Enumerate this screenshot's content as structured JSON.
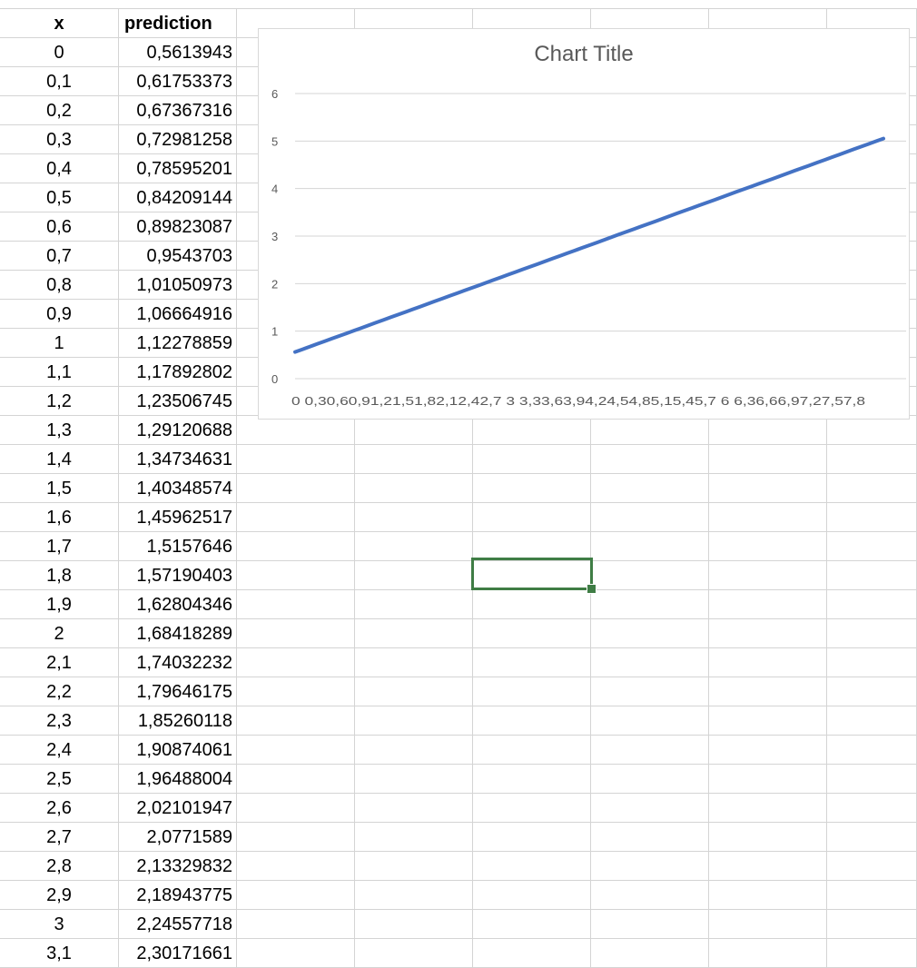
{
  "sheet": {
    "headers": {
      "x": "x",
      "prediction": "prediction"
    },
    "rows": [
      {
        "x": "0",
        "prediction": "0,5613943"
      },
      {
        "x": "0,1",
        "prediction": "0,61753373"
      },
      {
        "x": "0,2",
        "prediction": "0,67367316"
      },
      {
        "x": "0,3",
        "prediction": "0,72981258"
      },
      {
        "x": "0,4",
        "prediction": "0,78595201"
      },
      {
        "x": "0,5",
        "prediction": "0,84209144"
      },
      {
        "x": "0,6",
        "prediction": "0,89823087"
      },
      {
        "x": "0,7",
        "prediction": "0,9543703"
      },
      {
        "x": "0,8",
        "prediction": "1,01050973"
      },
      {
        "x": "0,9",
        "prediction": "1,06664916"
      },
      {
        "x": "1",
        "prediction": "1,12278859"
      },
      {
        "x": "1,1",
        "prediction": "1,17892802"
      },
      {
        "x": "1,2",
        "prediction": "1,23506745"
      },
      {
        "x": "1,3",
        "prediction": "1,29120688"
      },
      {
        "x": "1,4",
        "prediction": "1,34734631"
      },
      {
        "x": "1,5",
        "prediction": "1,40348574"
      },
      {
        "x": "1,6",
        "prediction": "1,45962517"
      },
      {
        "x": "1,7",
        "prediction": "1,5157646"
      },
      {
        "x": "1,8",
        "prediction": "1,57190403"
      },
      {
        "x": "1,9",
        "prediction": "1,62804346"
      },
      {
        "x": "2",
        "prediction": "1,68418289"
      },
      {
        "x": "2,1",
        "prediction": "1,74032232"
      },
      {
        "x": "2,2",
        "prediction": "1,79646175"
      },
      {
        "x": "2,3",
        "prediction": "1,85260118"
      },
      {
        "x": "2,4",
        "prediction": "1,90874061"
      },
      {
        "x": "2,5",
        "prediction": "1,96488004"
      },
      {
        "x": "2,6",
        "prediction": "2,02101947"
      },
      {
        "x": "2,7",
        "prediction": "2,0771589"
      },
      {
        "x": "2,8",
        "prediction": "2,13329832"
      },
      {
        "x": "2,9",
        "prediction": "2,18943775"
      },
      {
        "x": "3",
        "prediction": "2,24557718"
      },
      {
        "x": "3,1",
        "prediction": "2,30171661"
      }
    ]
  },
  "chart_data": {
    "type": "line",
    "title": "Chart Title",
    "x_start": 0,
    "x_end": 8,
    "x_step": 0.1,
    "y_at_x_start": 0.5613943,
    "y_slope": 0.5613943,
    "ylim": [
      0,
      6
    ],
    "y_ticks": [
      "0",
      "1",
      "2",
      "3",
      "4",
      "5",
      "6"
    ],
    "x_tick_text": "0 0,30,60,91,21,51,82,12,42,7 3 3,33,63,94,24,54,85,15,45,7 6 6,36,66,97,27,57,8",
    "grid": true,
    "legend": "none",
    "line_color": "#4472c4"
  },
  "colors": {
    "gridline": "#d4d4d4",
    "selection": "#3f7d45"
  }
}
